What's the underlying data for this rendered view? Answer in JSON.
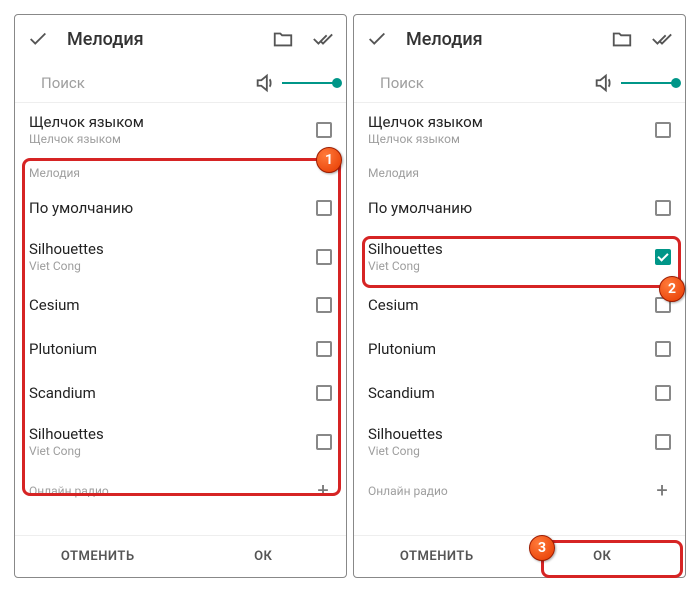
{
  "header": {
    "title": "Мелодия"
  },
  "search": {
    "placeholder": "Поиск"
  },
  "sections": {
    "tongue": {
      "title": "Щелчок языком",
      "sub": "Щелчок языком"
    },
    "melody_label": "Мелодия",
    "online_label": "Онлайн радио"
  },
  "items": [
    {
      "title": "По умолчанию",
      "sub": ""
    },
    {
      "title": "Silhouettes",
      "sub": "Viet Cong"
    },
    {
      "title": "Cesium",
      "sub": ""
    },
    {
      "title": "Plutonium",
      "sub": ""
    },
    {
      "title": "Scandium",
      "sub": ""
    },
    {
      "title": "Silhouettes",
      "sub": "Viet Cong"
    }
  ],
  "footer": {
    "cancel": "ОТМЕНИТЬ",
    "ok": "ОК"
  },
  "badges": {
    "one": "1",
    "two": "2",
    "three": "3"
  }
}
